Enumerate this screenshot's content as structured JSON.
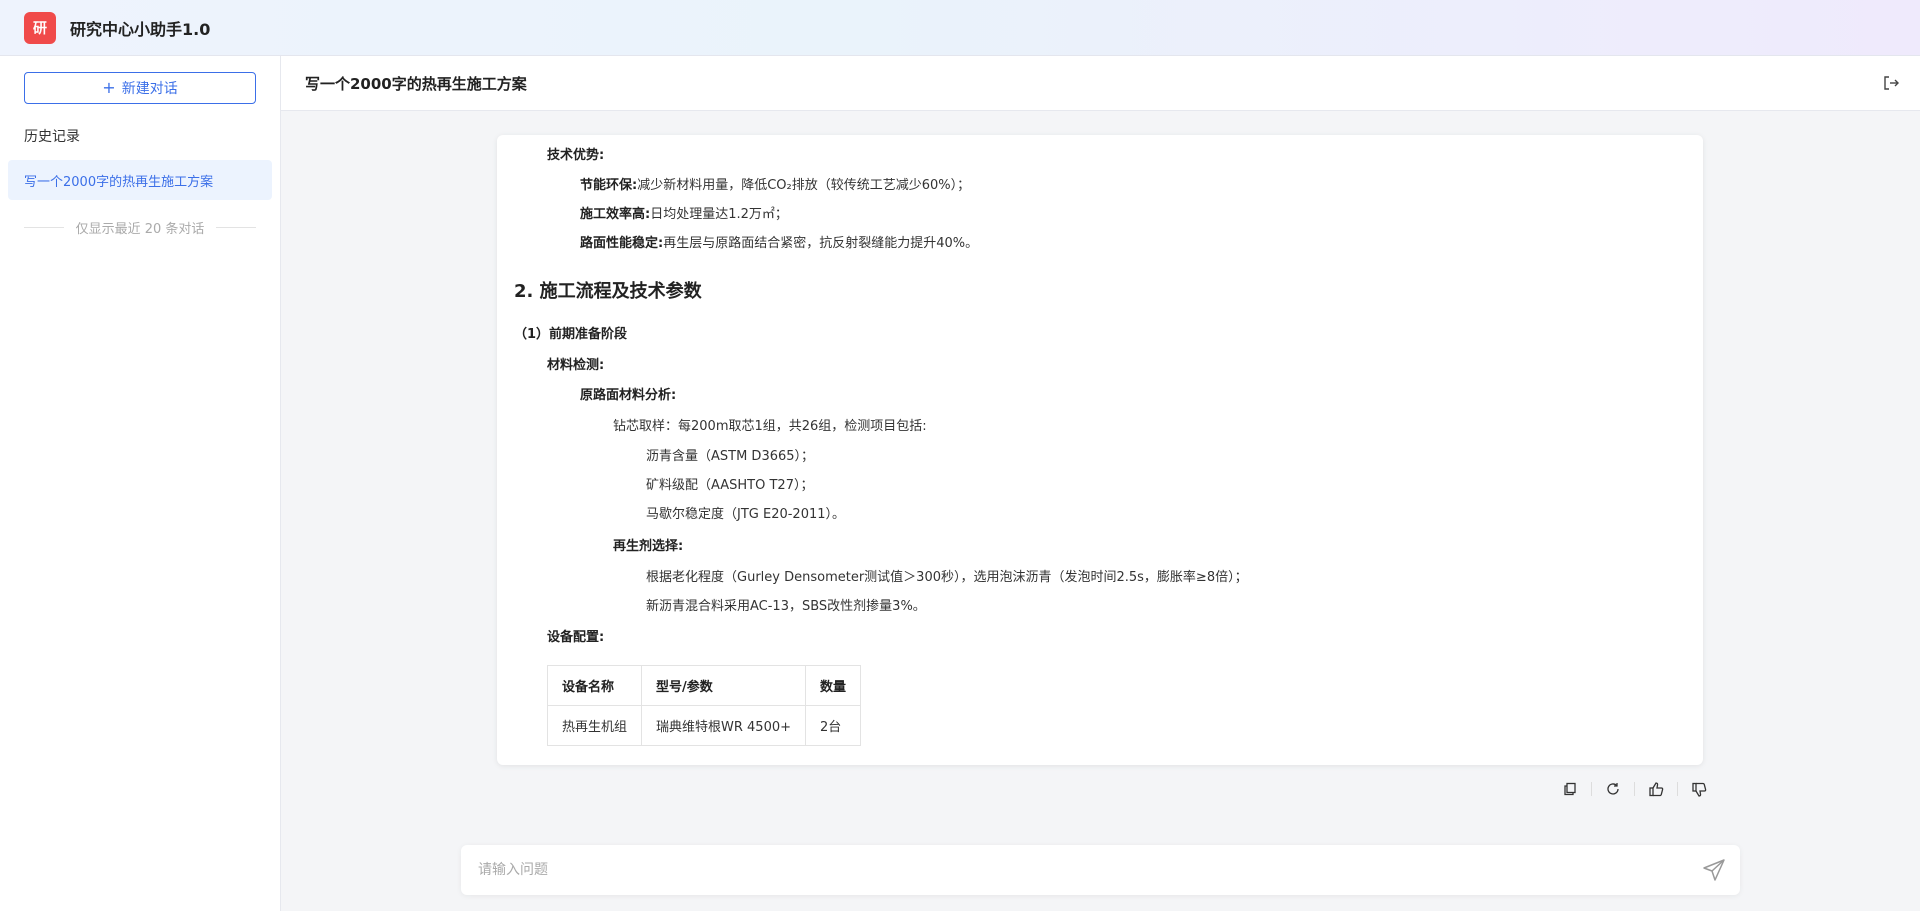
{
  "app": {
    "logo_char": "研",
    "title": "研究中心小助手1.0"
  },
  "sidebar": {
    "new_chat_label": "新建对话",
    "history_title": "历史记录",
    "history_items": [
      {
        "label": "写一个2000字的热再生施工方案"
      }
    ],
    "history_note": "仅显示最近 20 条对话"
  },
  "conversation": {
    "title": "写一个2000字的热再生施工方案",
    "content": {
      "tech_adv_title": "技术优势:",
      "tech_adv_items": [
        {
          "label": "节能环保:",
          "text": "减少新材料用量，降低CO₂排放（较传统工艺减少60%）；"
        },
        {
          "label": "施工效率高:",
          "text": "日均处理量达1.2万㎡；"
        },
        {
          "label": "路面性能稳定:",
          "text": "再生层与原路面结合紧密，抗反射裂缝能力提升40%。"
        }
      ],
      "section2_title": "2. 施工流程及技术参数",
      "sub1_title": "（1）前期准备阶段",
      "material_test": "材料检测:",
      "orig_analysis": "原路面材料分析:",
      "drill_core": "钻芯取样：每200m取芯1组，共26组，检测项目包括:",
      "drill_items": [
        "沥青含量（ASTM D3665）；",
        "矿料级配（AASHTO T27）；",
        "马歇尔稳定度（JTG E20-2011）。"
      ],
      "regen_select": "再生剂选择:",
      "regen_items": [
        "根据老化程度（Gurley Densometer测试值＞300秒），选用泡沫沥青（发泡时间2.5s，膨胀率≥8倍）；",
        "新沥青混合料采用AC-13，SBS改性剂掺量3%。"
      ],
      "equip_title": "设备配置:",
      "equip_table": {
        "headers": [
          "设备名称",
          "型号/参数",
          "数量"
        ],
        "rows": [
          [
            "热再生机组",
            "瑞典维特根WR 4500+",
            "2台"
          ]
        ]
      }
    }
  },
  "input": {
    "placeholder": "请输入问题"
  }
}
